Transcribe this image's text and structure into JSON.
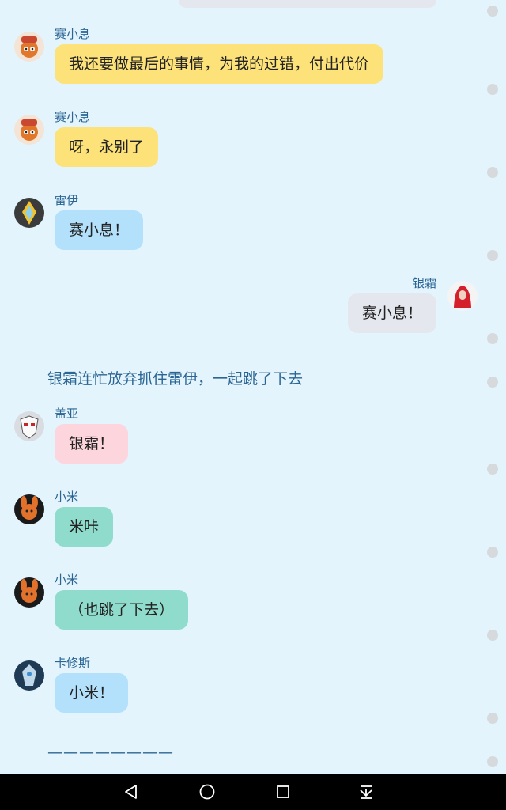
{
  "colors": {
    "background": "#e3f4fc",
    "bubble_yellow": "#fde27a",
    "bubble_blue": "#b3e1fb",
    "bubble_gray": "#e4e8ee",
    "bubble_pink": "#fdd5dd",
    "bubble_teal": "#8fdccd",
    "name_text": "#2a6594"
  },
  "messages": [
    {
      "sender": "赛小息",
      "text": "我还要做最后的事情，为我的过错，付出代价",
      "side": "left",
      "avatar": "saixiaoxi-avatar"
    },
    {
      "sender": "赛小息",
      "text": "呀，永别了",
      "side": "left",
      "avatar": "saixiaoxi-avatar"
    },
    {
      "sender": "雷伊",
      "text": "赛小息！",
      "side": "left",
      "avatar": "leiyi-avatar"
    },
    {
      "sender": "银霜",
      "text": "赛小息！",
      "side": "right",
      "avatar": "yinshuang-avatar"
    },
    {
      "sender": "盖亚",
      "text": "银霜！",
      "side": "left",
      "avatar": "gaiya-avatar"
    },
    {
      "sender": "小米",
      "text": "米咔",
      "side": "left",
      "avatar": "xiaomi-avatar"
    },
    {
      "sender": "小米",
      "text": "（也跳了下去）",
      "side": "left",
      "avatar": "xiaomi-avatar"
    },
    {
      "sender": "卡修斯",
      "text": "小米！",
      "side": "left",
      "avatar": "kaxiusi-avatar"
    }
  ],
  "narration": "银霜连忙放弃抓住雷伊，一起跳了下去",
  "divider": "————————",
  "navbar": {
    "back": "back-icon",
    "home": "home-icon",
    "recents": "recents-icon",
    "notifications": "pull-down-icon"
  }
}
